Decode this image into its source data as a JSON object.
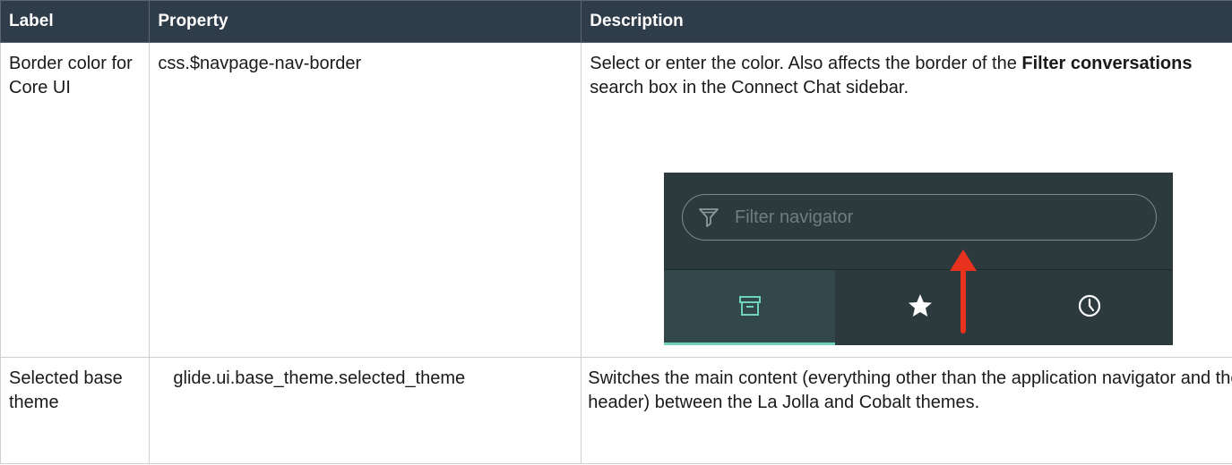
{
  "table": {
    "headers": {
      "label": "Label",
      "property": "Property",
      "description": "Description"
    },
    "rows": [
      {
        "label": "Border color for Core UI",
        "property": "css.$navpage-nav-border",
        "description_parts": {
          "before": "Select or enter the color. Also affects the border of the ",
          "bold": "Filter conversations",
          "after": " search box in the Connect Chat sidebar."
        }
      },
      {
        "label": "Selected base theme",
        "property": "glide.ui.base_theme.selected_theme",
        "description": "Switches the main content (everything other than the application navigator and the header) between the La Jolla and Cobalt themes."
      }
    ]
  },
  "screenshot": {
    "filter_placeholder": "Filter navigator",
    "icons": {
      "filter": "funnel-icon",
      "tab1": "archive-icon",
      "tab2": "star-icon",
      "tab3": "clock-icon",
      "arrow": "red-up-arrow-icon"
    },
    "colors": {
      "nav_background": "#2c3a3d",
      "active_tab": "#33484a",
      "active_underline": "#6fd3b9",
      "arrow": "#e8321e",
      "header_background": "#2f3c4a"
    }
  }
}
